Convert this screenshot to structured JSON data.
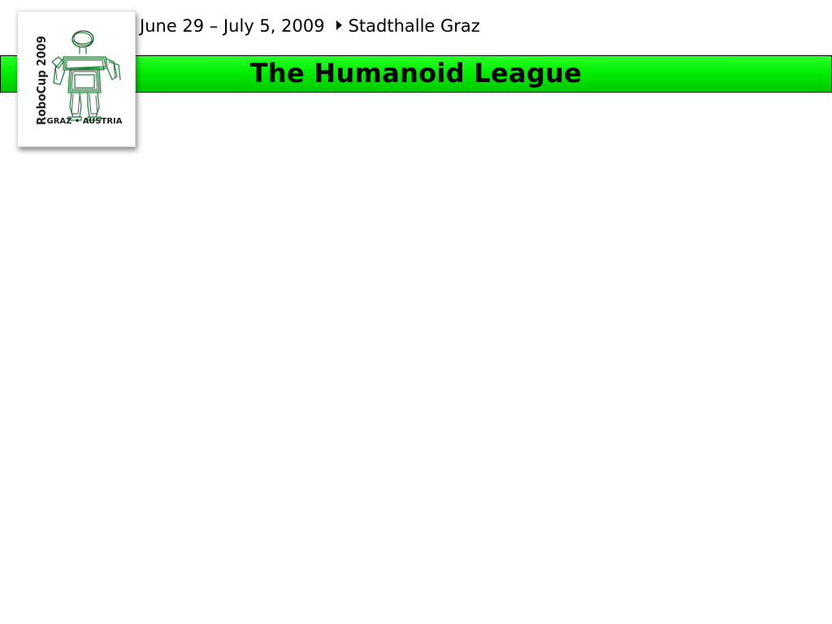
{
  "header": {
    "dates": "June 29 – July 5, 2009",
    "venue": "Stadthalle Graz"
  },
  "title": "The Humanoid League",
  "logo": {
    "name": "RoboCup 2009",
    "location": "GRAZ • AUSTRIA",
    "icon": "robot-logo",
    "accent_color": "#1f8a3a"
  },
  "colors": {
    "title_bar": "#00e600",
    "background": "#ffffff",
    "text": "#000000"
  }
}
